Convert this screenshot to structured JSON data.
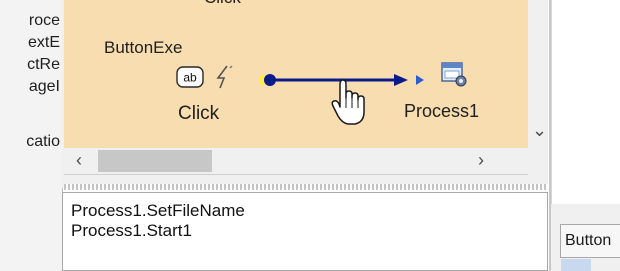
{
  "left_list": {
    "items": [
      "roce",
      "extE",
      "ctRe",
      "ageI",
      "catio"
    ]
  },
  "designer": {
    "top_label": "Click",
    "source_component": "ButtonExe",
    "source_event": "Click",
    "target_component": "Process1"
  },
  "code": {
    "lines": [
      "Process1.SetFileName",
      "Process1.Start1"
    ]
  },
  "properties": {
    "header": "Button"
  },
  "colors": {
    "canvas_background": "#f7ddb0",
    "connection_line": "#0b1b8c",
    "start_dot": "#fff23a"
  }
}
